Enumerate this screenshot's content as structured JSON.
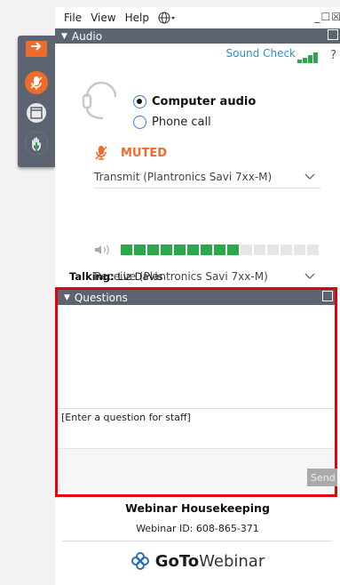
{
  "menu": {
    "file": "File",
    "view": "View",
    "help": "Help",
    "window_controls": "_☐☒"
  },
  "toolbar": {
    "icons": [
      "arrow-right-icon",
      "mic-muted-icon",
      "window-icon",
      "raise-hand-icon"
    ],
    "accent": "#ee6b2c"
  },
  "audio": {
    "header": "Audio",
    "sound_check": "Sound Check",
    "help": "?",
    "option_computer": "Computer audio",
    "option_phone": "Phone call",
    "selected": "Computer audio",
    "muted": "MUTED",
    "transmit": "Transmit (Plantronics Savi 7xx-M)",
    "receive": "Receive (Plantronics Savi 7xx-M)",
    "volume_level": 0.6
  },
  "talking": {
    "label": "Talking:",
    "name": "Liz Davis"
  },
  "questions": {
    "header": "Questions",
    "input_placeholder": "[Enter a question for staff]",
    "send": "Send"
  },
  "footer": {
    "title": "Webinar Housekeeping",
    "webinar_id": "Webinar ID: 608-865-371",
    "brand_goto": "GoTo",
    "brand_webinar": "Webinar"
  },
  "colors": {
    "header_bg": "#5c6472",
    "link": "#2a8fd4",
    "meter_on": "#2ba84a",
    "highlight": "#e3000f"
  }
}
